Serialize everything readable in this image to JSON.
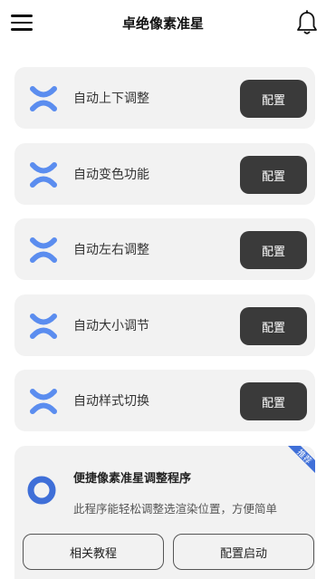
{
  "header": {
    "title": "卓绝像素准星",
    "menu_icon": "hamburger-menu-icon",
    "bell_icon": "bell-icon"
  },
  "colors": {
    "accent": "#5b8def",
    "button_dark": "#3a3a3a",
    "card_bg": "#f2f2f2"
  },
  "features": [
    {
      "label": "自动上下调整",
      "button": "配置"
    },
    {
      "label": "自动变色功能",
      "button": "配置"
    },
    {
      "label": "自动左右调整",
      "button": "配置"
    },
    {
      "label": "自动大小调节",
      "button": "配置"
    },
    {
      "label": "自动样式切换",
      "button": "配置"
    }
  ],
  "promo": {
    "badge": "推荐",
    "title": "便捷像素准星调整程序",
    "description": "此程序能轻松调整选渲染位置，方便简单",
    "buttons": [
      "相关教程",
      "配置启动"
    ]
  }
}
